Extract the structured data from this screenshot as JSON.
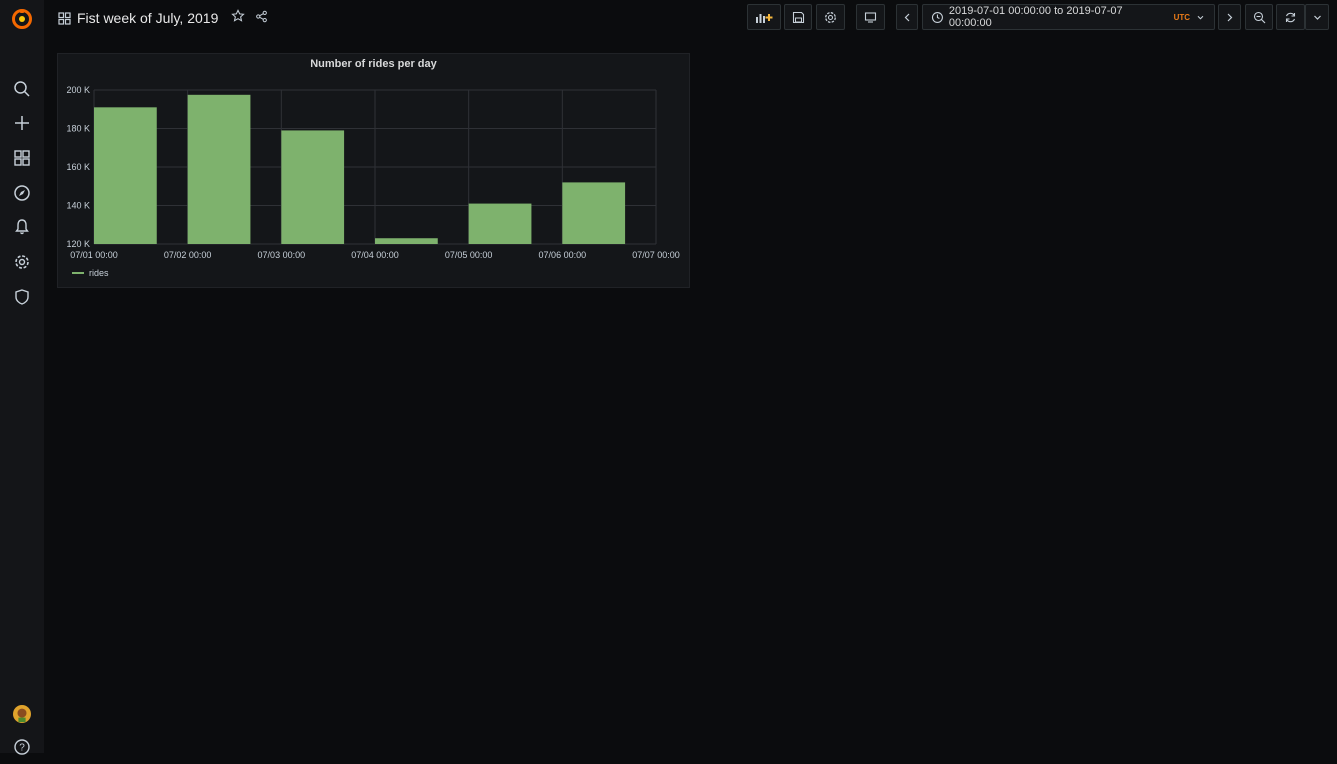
{
  "dashboard": {
    "title": "Fist week of July, 2019"
  },
  "time_range": {
    "label": "2019-07-01 00:00:00 to 2019-07-07 00:00:00",
    "timezone": "UTC"
  },
  "sidebar": {
    "icons": [
      "grafana-logo-icon",
      "search-icon",
      "plus-icon",
      "dashboards-icon",
      "explore-icon",
      "alerting-icon",
      "configuration-icon",
      "server-admin-icon",
      "user-avatar",
      "help-icon"
    ]
  },
  "toolbar": {
    "icons": [
      "add-panel-icon",
      "save-icon",
      "settings-icon",
      "tv-mode-icon",
      "time-back-icon",
      "time-forward-icon",
      "zoom-out-icon",
      "refresh-icon",
      "refresh-interval-chevron-icon"
    ]
  },
  "panel": {
    "title": "Number of rides per day",
    "legend": "rides"
  },
  "chart_data": {
    "type": "bar",
    "title": "Number of rides per day",
    "color": "#7eb26d",
    "categories": [
      "07/01 00:00",
      "07/02 00:00",
      "07/03 00:00",
      "07/04 00:00",
      "07/05 00:00",
      "07/06 00:00",
      "07/07 00:00"
    ],
    "series": [
      {
        "name": "rides",
        "values": [
          191000,
          197500,
          179000,
          123000,
          141000,
          152000
        ]
      }
    ],
    "y_ticks": [
      "200 K",
      "180 K",
      "160 K",
      "140 K",
      "120 K"
    ],
    "ylim": [
      120000,
      200000
    ],
    "grid": true,
    "legend_position": "bottom-left"
  }
}
